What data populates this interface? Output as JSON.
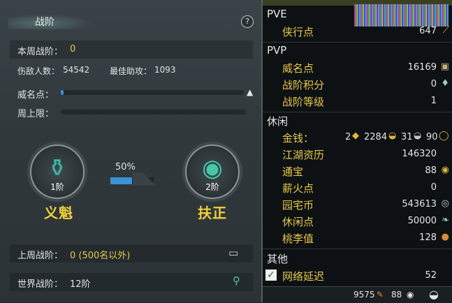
{
  "left": {
    "title": "战阶",
    "help_icon": "question-icon",
    "week_rank_label": "本周战阶：",
    "week_rank_value": "0",
    "kills_label": "伤敌人数：",
    "kills_value": "54542",
    "assist_label": "最佳助攻：",
    "assist_value": "1093",
    "prestige_label": "威名点：",
    "weekly_cap_label": "周上限：",
    "prestige_fill": 0.01,
    "weekly_cap_fill": 0.0,
    "badge_left_level": "1阶",
    "badge_left_name": "义魁",
    "badge_right_level": "2阶",
    "badge_right_name": "扶正",
    "progress_pct": "50%",
    "progress_fraction": 0.5,
    "last_week_label": "上周战阶：",
    "last_week_value": "0 (500名以外)",
    "world_rank_label": "世界战阶：",
    "world_rank_value": "12阶"
  },
  "right": {
    "pve": {
      "header": "PVE",
      "items": [
        {
          "label": "侠行点",
          "value": "647",
          "icon": "sword-icon"
        }
      ]
    },
    "pvp": {
      "header": "PVP",
      "items": [
        {
          "label": "威名点",
          "value": "16169",
          "icon": "banner-icon"
        },
        {
          "label": "战阶积分",
          "value": "0",
          "icon": "crest-icon"
        },
        {
          "label": "战阶等级",
          "value": "1",
          "icon": ""
        }
      ]
    },
    "leisure": {
      "header": "休闲",
      "money_label": "金钱：",
      "money_gold_bars": "2",
      "money_gold": "2284",
      "money_silver": "31",
      "money_copper": "90",
      "items": [
        {
          "label": "江湖资历",
          "value": "146320",
          "icon": ""
        },
        {
          "label": "通宝",
          "value": "88",
          "icon": "coin-icon"
        },
        {
          "label": "薪火点",
          "value": "0",
          "icon": ""
        },
        {
          "label": "园宅币",
          "value": "543613",
          "icon": "house-coin-icon"
        },
        {
          "label": "休闲点",
          "value": "50000",
          "icon": "leaf-icon"
        },
        {
          "label": "桃李值",
          "value": "128",
          "icon": "gourd-icon"
        }
      ]
    },
    "other": {
      "header": "其他",
      "latency_label": "网络延迟",
      "latency_value": "52",
      "latency_checked": true
    },
    "bottom": {
      "value_a": "9575",
      "value_b": "88"
    }
  }
}
